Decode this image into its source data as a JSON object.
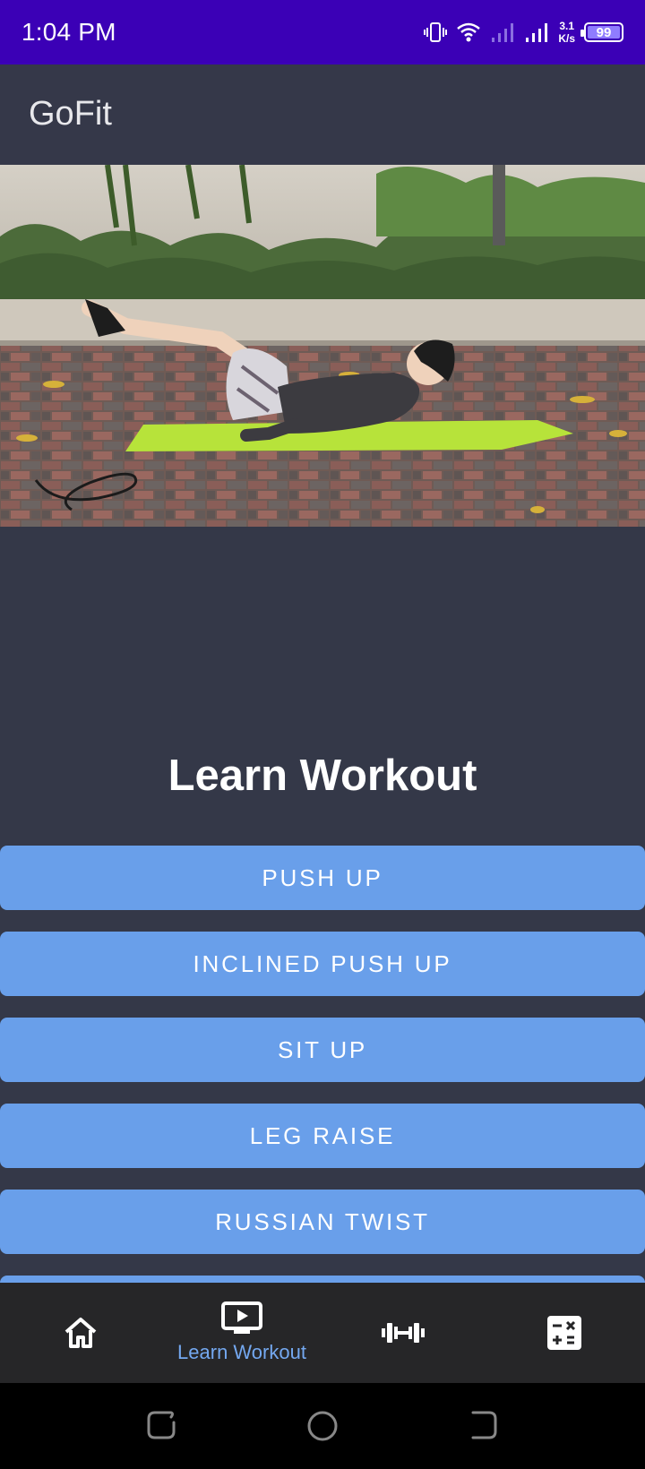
{
  "status_bar": {
    "time": "1:04 PM",
    "net_speed_value": "3.1",
    "net_speed_unit": "K/s",
    "battery": "99",
    "icons": [
      "vibrate-icon",
      "wifi-icon",
      "signal-icon",
      "signal-icon",
      "battery-icon"
    ]
  },
  "app_bar": {
    "title": "GoFit"
  },
  "video": {
    "description_icon": "video-player"
  },
  "main": {
    "heading": "Learn Workout",
    "workouts": [
      "PUSH UP",
      "INCLINED PUSH UP",
      "SIT UP",
      "LEG RAISE",
      "RUSSIAN TWIST"
    ]
  },
  "bottom_nav": {
    "items": [
      {
        "icon": "home-icon",
        "label": ""
      },
      {
        "icon": "video-lesson-icon",
        "label": "Learn Workout"
      },
      {
        "icon": "dumbbell-icon",
        "label": ""
      },
      {
        "icon": "calculator-icon",
        "label": ""
      }
    ],
    "active_index": 1
  },
  "colors": {
    "status_bar": "#3b00b6",
    "background": "#343848",
    "button": "#699fea",
    "nav_background": "#262628",
    "active_label": "#74a8f0"
  }
}
